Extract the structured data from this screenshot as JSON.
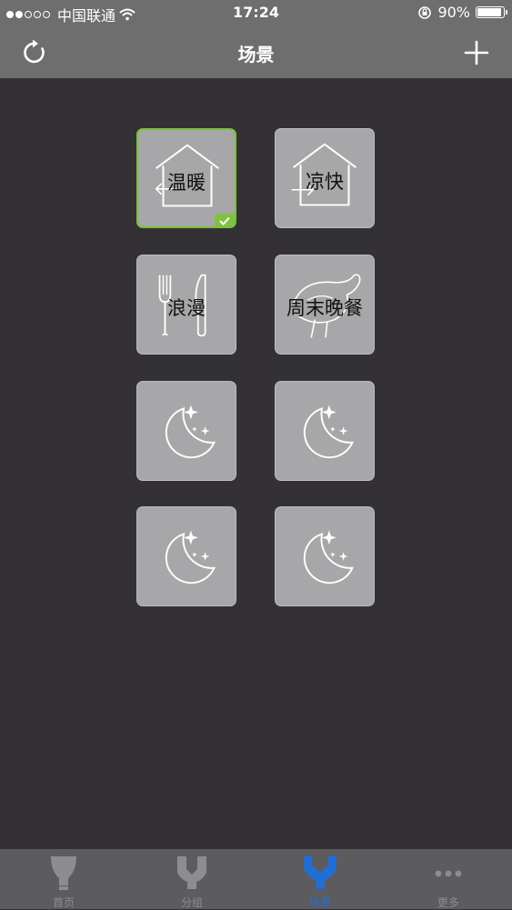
{
  "status_bar": {
    "carrier": "中国联通",
    "time": "17:24",
    "battery": "90%"
  },
  "header": {
    "title": "场景"
  },
  "scenes": [
    {
      "label": "温暖",
      "icon": "house-arrow-left-icon",
      "selected": true
    },
    {
      "label": "凉快",
      "icon": "house-arrow-right-icon",
      "selected": false
    },
    {
      "label": "浪漫",
      "icon": "fork-knife-icon",
      "selected": false
    },
    {
      "label": "周末晚餐",
      "icon": "chicken-icon",
      "selected": false
    },
    {
      "label": "",
      "icon": "moon-stars-icon",
      "selected": false
    },
    {
      "label": "",
      "icon": "moon-stars-icon",
      "selected": false
    },
    {
      "label": "",
      "icon": "moon-stars-icon",
      "selected": false
    },
    {
      "label": "",
      "icon": "moon-stars-icon",
      "selected": false
    }
  ],
  "tabs": [
    {
      "label": "首页",
      "icon": "bulb-icon"
    },
    {
      "label": "分组",
      "icon": "group-icon"
    },
    {
      "label": "场景",
      "icon": "scene-icon",
      "active": true
    },
    {
      "label": "更多",
      "icon": "more-dots-icon"
    }
  ],
  "colors": {
    "accent": "#1f6fd8",
    "selected_border": "#79c13e",
    "background": "#333133",
    "bar": "#6e6e6e"
  }
}
